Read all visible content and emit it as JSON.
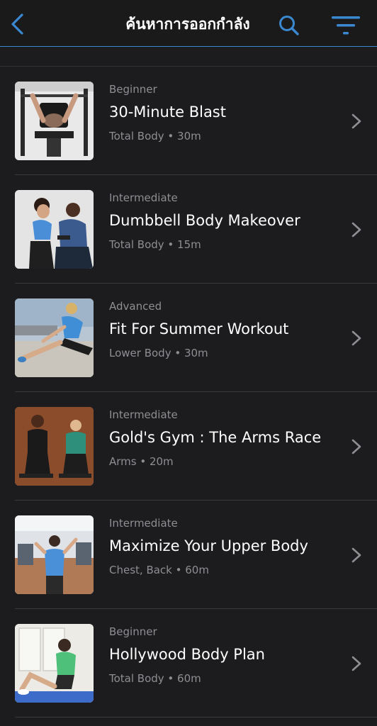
{
  "nav": {
    "title": "ค้นหาการออกกำลัง",
    "back_icon": "chevron-left-icon",
    "search_icon": "search-icon",
    "filter_icon": "filter-icon",
    "accent": "#3a88d0"
  },
  "workouts": [
    {
      "level": "Beginner",
      "title": "30-Minute Blast",
      "meta": "Total Body • 30m",
      "thumb": "bench-press-photo"
    },
    {
      "level": "Intermediate",
      "title": "Dumbbell Body Makeover",
      "meta": "Total Body • 15m",
      "thumb": "dumbbell-couple-photo"
    },
    {
      "level": "Advanced",
      "title": "Fit For Summer Workout",
      "meta": "Lower Body • 30m",
      "thumb": "stretch-outdoor-photo"
    },
    {
      "level": "Intermediate",
      "title": "Gold's Gym : The Arms Race",
      "meta": "Arms • 20m",
      "thumb": "arms-race-photo"
    },
    {
      "level": "Intermediate",
      "title": "Maximize Your Upper Body",
      "meta": "Chest, Back • 60m",
      "thumb": "upper-body-gym-photo"
    },
    {
      "level": "Beginner",
      "title": "Hollywood Body Plan",
      "meta": "Total Body • 60m",
      "thumb": "situp-mat-photo"
    }
  ]
}
